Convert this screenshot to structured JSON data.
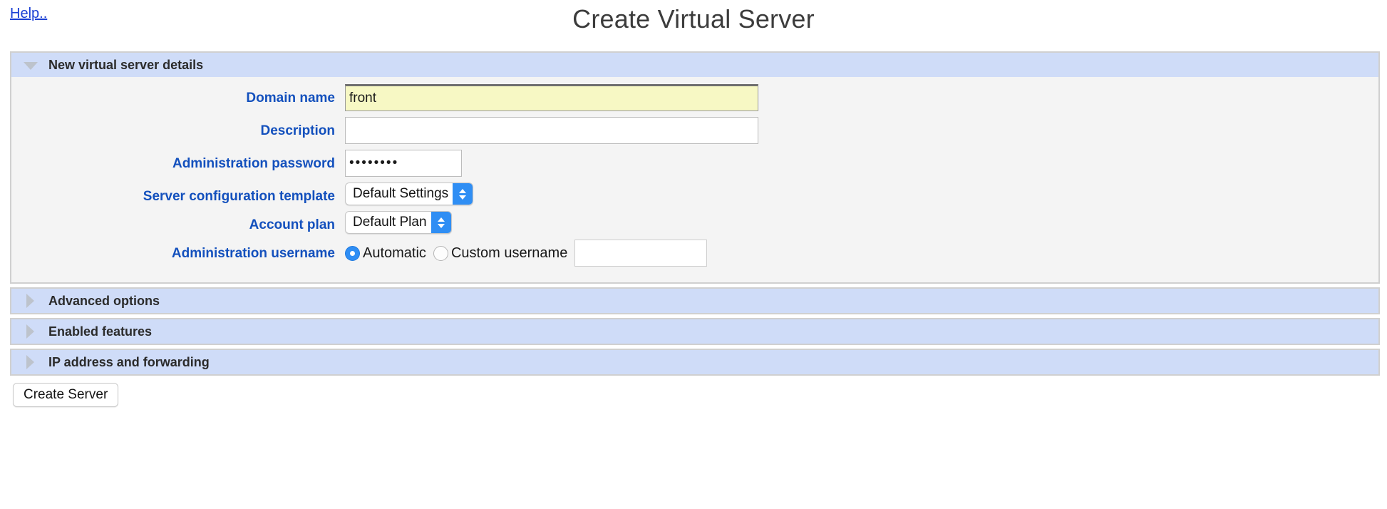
{
  "header": {
    "help_label": "Help..",
    "title": "Create Virtual Server"
  },
  "sections": [
    {
      "id": "new-virtual-server-details",
      "title": "New virtual server details",
      "expanded": true,
      "triangle": "chevron-down-icon"
    },
    {
      "id": "advanced-options",
      "title": "Advanced options",
      "expanded": false,
      "triangle": "chevron-right-icon"
    },
    {
      "id": "enabled-features",
      "title": "Enabled features",
      "expanded": false,
      "triangle": "chevron-right-icon"
    },
    {
      "id": "ip-address-and-forwarding",
      "title": "IP address and forwarding",
      "expanded": false,
      "triangle": "chevron-right-icon"
    }
  ],
  "form": {
    "domain_name": {
      "label": "Domain name",
      "value": "front",
      "placeholder": "",
      "focused": true
    },
    "description": {
      "label": "Description",
      "value": "",
      "placeholder": ""
    },
    "administration_password": {
      "label": "Administration password",
      "value": "••••••••",
      "placeholder": ""
    },
    "server_configuration_template": {
      "label": "Server configuration template",
      "selected": "Default Settings"
    },
    "account_plan": {
      "label": "Account plan",
      "selected": "Default Plan"
    },
    "administration_username": {
      "label": "Administration username",
      "automatic_label": "Automatic",
      "custom_label": "Custom username",
      "selected": "Automatic",
      "custom_value": "",
      "custom_placeholder": ""
    }
  },
  "footer": {
    "submit_label": "Create Server"
  },
  "colors": {
    "label_blue": "#1350bd",
    "link_blue": "#1a3fd4",
    "section_header_blue": "#cfdcf8",
    "panel_body_gray": "#f4f4f4",
    "focused_input_yellow": "#f7f8c4",
    "accent_blue": "#2f8ef4",
    "title_gray": "#3c3c3c"
  }
}
